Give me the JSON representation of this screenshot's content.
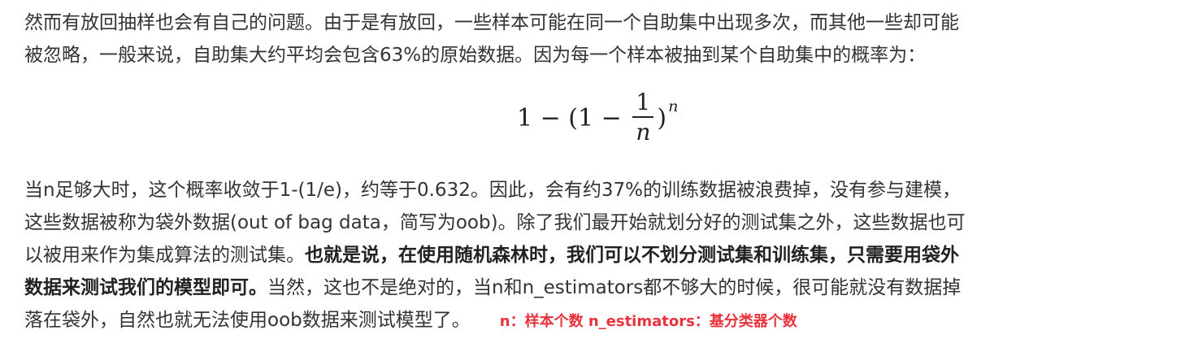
{
  "paragraph1": {
    "line1": "然而有放回抽样也会有自己的问题。由于是有放回，一些样本可能在同一个自助集中出现多次，而其他一些却可能",
    "line2": "被忽略，一般来说，自助集大约平均会包含63%的原始数据。因为每一个样本被抽到某个自助集中的概率为："
  },
  "formula": {
    "one": "1",
    "minus": " − (1 − ",
    "numerator": "1",
    "denominator": "n",
    "close_paren": ")",
    "exponent": "n"
  },
  "paragraph2": {
    "line1": "当n足够大时，这个概率收敛于1-(1/e)，约等于0.632。因此，会有约37%的训练数据被浪费掉，没有参与建模，",
    "line2": "这些数据被称为袋外数据(out of bag data，简写为oob)。除了我们最开始就划分好的测试集之外，这些数据也可",
    "line3_normal": "以被用来作为集成算法的测试集。",
    "line3_bold": "也就是说，在使用随机森林时，我们可以不划分测试集和训练集，只需要用袋外",
    "line4_bold": "数据来测试我们的模型即可。",
    "line4_normal": "当然，这也不是绝对的，当n和n_estimators都不够大的时候，很可能就没有数据掉",
    "line5_normal": "落在袋外，自然也就无法使用oob数据来测试模型了。",
    "annotation": "n：样本个数  n_estimators：基分类器个数"
  },
  "colors": {
    "text": "#333333",
    "annotation": "#e8323c"
  }
}
